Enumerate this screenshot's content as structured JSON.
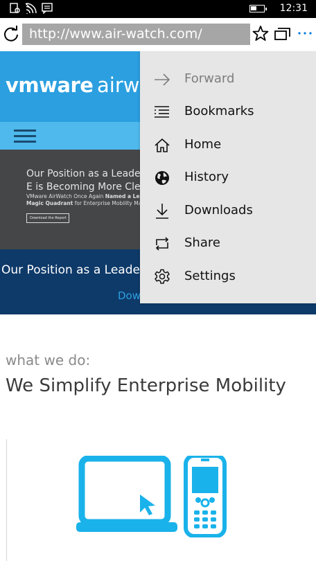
{
  "status_bar": {
    "time": "12:31",
    "battery_level": 0.45,
    "icons": [
      "contact-card-icon",
      "wifi-icon",
      "message-icon"
    ]
  },
  "browser": {
    "url": "http://www.air-watch.com/",
    "accent_color": "#0078d7"
  },
  "menu": {
    "items": [
      {
        "label": "Forward",
        "icon": "forward-arrow-icon",
        "enabled": false
      },
      {
        "label": "Bookmarks",
        "icon": "bookmarks-list-icon",
        "enabled": true
      },
      {
        "label": "Home",
        "icon": "home-icon",
        "enabled": true
      },
      {
        "label": "History",
        "icon": "globe-icon",
        "enabled": true
      },
      {
        "label": "Downloads",
        "icon": "download-icon",
        "enabled": true
      },
      {
        "label": "Share",
        "icon": "share-icon",
        "enabled": true
      },
      {
        "label": "Settings",
        "icon": "gear-icon",
        "enabled": true
      }
    ]
  },
  "page": {
    "logo_vmware": "vmware",
    "logo_airwatch": "airwatch",
    "hero_title": "Our Position as a Leader in E is Becoming More Clear",
    "hero_subtitle_plain_start": "VMware AirWatch Once Again ",
    "hero_subtitle_bold_1": "Named a Leader",
    "hero_subtitle_bold_2": "Magic Quadrant",
    "hero_subtitle_plain_end": " for Enterprise Mobility Manag",
    "hero_button": "Download the Report",
    "blue_banner_text": "Our Position as a Leader i",
    "blue_banner_link": "Down",
    "section_eyebrow": "what we do:",
    "section_title": "We Simplify Enterprise Mobility",
    "colors": {
      "brand_blue": "#2b9fe0",
      "nav_blue": "#4fb9ed",
      "dark_navy": "#0e3a69",
      "illustration_blue": "#1ab2ea"
    }
  }
}
